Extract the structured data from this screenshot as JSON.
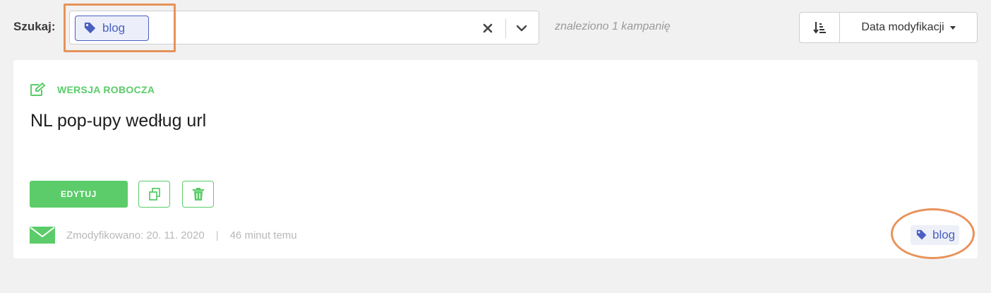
{
  "search": {
    "label": "Szukaj:",
    "tag_filter": "blog",
    "results_text": "znaleziono 1 kampanię"
  },
  "sort": {
    "field_label": "Data modyfikacji"
  },
  "campaign": {
    "status": "WERSJA ROBOCZA",
    "title": "NL pop-upy według url",
    "edit_label": "EDYTUJ",
    "modified": "Zmodyfikowano: 20. 11. 2020",
    "separator": "|",
    "relative_time": "46 minut temu",
    "tag": "blog"
  },
  "colors": {
    "accent_green": "#5bcc69",
    "tag_blue": "#4a5fc1",
    "highlight_orange": "#e8925a"
  },
  "icons": {
    "tag": "tag-icon",
    "clear": "close-icon",
    "dropdown": "chevron-down-icon",
    "sort_order": "sort-descending-icon",
    "status": "edit-icon",
    "copy": "copy-icon",
    "delete": "trash-icon",
    "channel": "envelope-icon"
  }
}
